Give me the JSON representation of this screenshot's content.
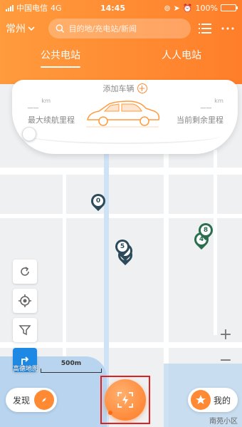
{
  "status_bar": {
    "carrier": "中国电信",
    "network": "4G",
    "time": "14:45",
    "battery": "100%"
  },
  "header": {
    "city": "常州",
    "search_placeholder": "目的地/充电站/新闻",
    "tabs": [
      {
        "label": "公共电站",
        "active": true
      },
      {
        "label": "人人电站",
        "active": false
      }
    ]
  },
  "car_card": {
    "add_vehicle": "添加车辆",
    "max_range_value": "__",
    "max_range_unit": "km",
    "max_range_label": "最大续航里程",
    "remaining_value": "__",
    "remaining_unit": "km",
    "remaining_label": "当前剩余里程"
  },
  "markers": [
    {
      "count": "0",
      "color": "dark"
    },
    {
      "count": "5",
      "color": "dark"
    },
    {
      "count": "",
      "color": "dark"
    },
    {
      "count": "",
      "color": "dark"
    },
    {
      "count": "8",
      "color": "green"
    },
    {
      "count": "4",
      "color": "green"
    }
  ],
  "map": {
    "scale_label": "500m",
    "map_credit": "高德地图",
    "district": "南苑小区"
  },
  "controls": {
    "zoom_in": "+",
    "zoom_out": "−"
  },
  "bottom": {
    "discover_label": "发现",
    "mine_label": "我的"
  },
  "colors": {
    "brand_orange": "#ff8a33",
    "marker_dark": "#2d4a5a",
    "marker_green": "#2a6e4e",
    "locate_blue": "#1e88e5",
    "highlight_red": "#e02020"
  }
}
